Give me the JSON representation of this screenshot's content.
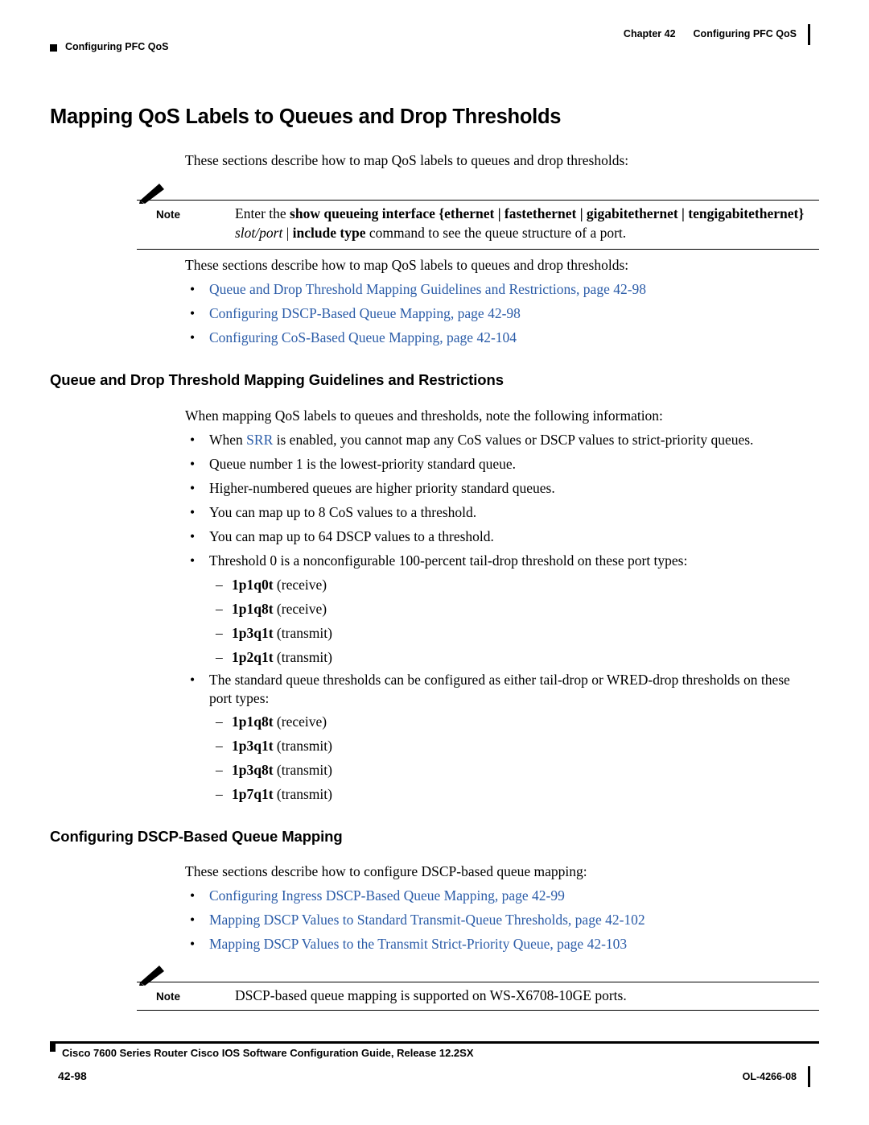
{
  "header": {
    "left_label": "Configuring PFC QoS",
    "chapter": "Chapter 42",
    "chapter_title": "Configuring PFC QoS"
  },
  "title": "Mapping QoS Labels to Queues and Drop Thresholds",
  "intro1": "These sections describe how to map QoS labels to queues and drop thresholds:",
  "note1": {
    "label": "Note",
    "line1_pre": "Enter the ",
    "line1_bold": "show queueing interface",
    "line1_mid": " {ethernet | fastethernet | gigabitethernet | tengigabitethernet}",
    "line2_italic": "slot/port",
    "line2_mid": " | ",
    "line2_bold": "include type",
    "line2_post": " command to see the queue structure of a port."
  },
  "intro2": "These sections describe how to map QoS labels to queues and drop thresholds:",
  "toc1": [
    "Queue and Drop Threshold Mapping Guidelines and Restrictions, page 42-98",
    "Configuring DSCP-Based Queue Mapping, page 42-98",
    "Configuring CoS-Based Queue Mapping, page 42-104"
  ],
  "section1": {
    "heading": "Queue and Drop Threshold Mapping Guidelines and Restrictions",
    "intro": "When mapping QoS labels to queues and thresholds, note the following information:",
    "bullets": [
      {
        "pre": "When ",
        "link": "SRR",
        "post": " is enabled, you cannot map any CoS values or DSCP values to strict-priority queues."
      },
      {
        "pre": "Queue number 1 is the lowest-priority standard queue.",
        "link": "",
        "post": ""
      },
      {
        "pre": "Higher-numbered queues are higher priority standard queues.",
        "link": "",
        "post": ""
      },
      {
        "pre": "You can map up to 8 CoS values to a threshold.",
        "link": "",
        "post": ""
      },
      {
        "pre": "You can map up to 64 DSCP values to a threshold.",
        "link": "",
        "post": ""
      },
      {
        "pre": "Threshold 0 is a nonconfigurable 100-percent tail-drop threshold on these port types:",
        "link": "",
        "post": ""
      }
    ],
    "port_types_1": [
      {
        "name": "1p1q0t",
        "qual": "(receive)"
      },
      {
        "name": "1p1q8t",
        "qual": "(receive)"
      },
      {
        "name": "1p3q1t",
        "qual": "(transmit)"
      },
      {
        "name": "1p2q1t",
        "qual": "(transmit)"
      }
    ],
    "bullet_wred": "The standard queue thresholds can be configured as either tail-drop or WRED-drop thresholds on these port types:",
    "port_types_2": [
      {
        "name": "1p1q8t",
        "qual": "(receive)"
      },
      {
        "name": "1p3q1t",
        "qual": "(transmit)"
      },
      {
        "name": "1p3q8t",
        "qual": "(transmit)"
      },
      {
        "name": "1p7q1t",
        "qual": "(transmit)"
      }
    ]
  },
  "section2": {
    "heading": "Configuring DSCP-Based Queue Mapping",
    "intro": "These sections describe how to configure DSCP-based queue mapping:",
    "toc": [
      "Configuring Ingress DSCP-Based Queue Mapping, page 42-99",
      "Mapping DSCP Values to Standard Transmit-Queue Thresholds, page 42-102",
      "Mapping DSCP Values to the Transmit Strict-Priority Queue, page 42-103"
    ]
  },
  "note2": {
    "label": "Note",
    "text": "DSCP-based queue mapping is supported on WS-X6708-10GE ports."
  },
  "footer": {
    "title": "Cisco 7600 Series Router Cisco IOS Software Configuration Guide, Release 12.2SX",
    "page": "42-98",
    "doc_id": "OL-4266-08"
  },
  "colors": {
    "link": "#2b5ca8",
    "text": "#000000",
    "background": "#ffffff"
  }
}
